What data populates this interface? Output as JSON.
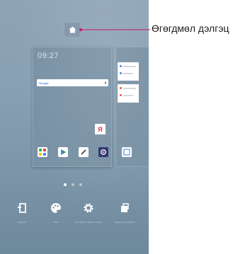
{
  "callout": {
    "label": "Өгөгдмөл дэлгэц",
    "line_color": "#d0126c"
  },
  "preview": {
    "time": "09:27",
    "date_line": "",
    "search_logo": "Google",
    "yandex_letter": "Я"
  },
  "page_indicator": {
    "count": 3,
    "active": 0
  },
  "bottom_menu": [
    {
      "icon": "widgets-icon",
      "label": "Виджеты"
    },
    {
      "icon": "themes-icon",
      "label": "Темы"
    },
    {
      "icon": "settings-icon",
      "label": "Настройки главного экрана"
    },
    {
      "icon": "sort-apps-icon",
      "label": "Экраны приложений"
    }
  ],
  "colors": {
    "accent": "#d0126c",
    "wallpaper": "#88a0b3",
    "settings_app": "#2d2f6b",
    "yandex_red": "#e32525"
  }
}
